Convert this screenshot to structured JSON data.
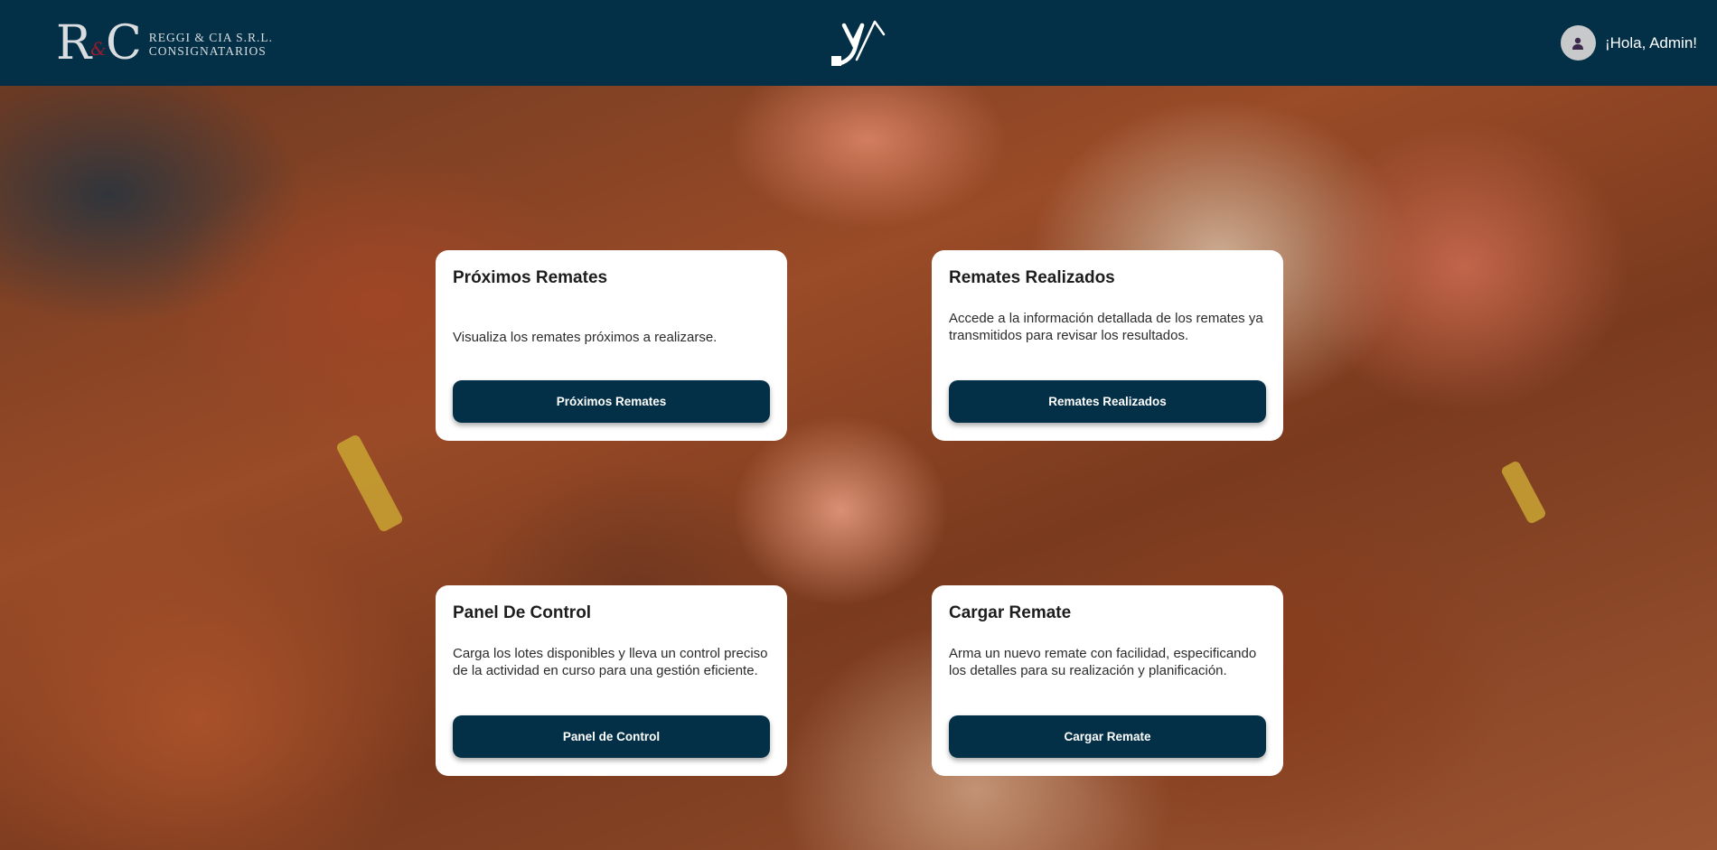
{
  "header": {
    "brand_monogram_left": "R",
    "brand_monogram_amp": "&",
    "brand_monogram_right": "C",
    "brand_line1": "REGGI & CIA S.R.L.",
    "brand_line2": "CONSIGNATARIOS",
    "center_logo_icon": "stylized-y-arrow-logo",
    "greeting": "¡Hola, Admin!",
    "avatar_icon": "user-avatar-icon",
    "background_color": "#033047"
  },
  "cards": [
    {
      "title": "Próximos Remates",
      "description": "Visualiza los remates próximos a realizarse.",
      "button": "Próximos Remates"
    },
    {
      "title": "Remates Realizados",
      "description": "Accede a la información detallada de los remates ya transmitidos para revisar los resultados.",
      "button": "Remates Realizados"
    },
    {
      "title": "Panel De Control",
      "description": "Carga los lotes disponibles y lleva un control preciso de la actividad en curso para una gestión eficiente.",
      "button": "Panel de Control"
    },
    {
      "title": "Cargar Remate",
      "description": "Arma un nuevo remate con facilidad, especificando los detalles para su realización y planificación.",
      "button": "Cargar Remate"
    }
  ],
  "colors": {
    "accent": "#033047",
    "card_background": "#ffffff"
  }
}
